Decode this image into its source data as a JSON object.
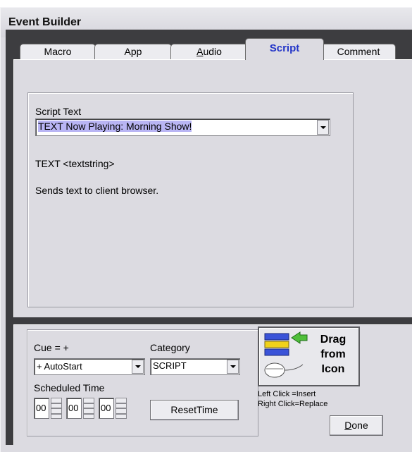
{
  "window": {
    "title": "Event Builder"
  },
  "tabs": [
    {
      "label": "Macro",
      "active": false
    },
    {
      "label": "App",
      "active": false
    },
    {
      "label": "Audio",
      "accel": "A",
      "rest": "udio",
      "active": false
    },
    {
      "label": "Script",
      "active": true
    },
    {
      "label": "Comment",
      "active": false
    }
  ],
  "script": {
    "label": "Script Text",
    "value": "TEXT Now Playing: Morning Show!",
    "syntax": "TEXT <textstring>",
    "description": "Sends text to client browser."
  },
  "cue": {
    "label": "Cue = +",
    "value": "+ AutoStart"
  },
  "category": {
    "label": "Category",
    "value": "SCRIPT"
  },
  "scheduled": {
    "label": "Scheduled Time",
    "hours": "00",
    "minutes": "00",
    "seconds": "00",
    "reset_label": "ResetTime"
  },
  "drag": {
    "line1": "Drag",
    "line2": "from",
    "line3": "Icon",
    "hint_left": "Left Click  =Insert",
    "hint_right": "Right Click=Replace"
  },
  "done": {
    "label": "Done",
    "accel": "D",
    "rest": "one"
  },
  "colors": {
    "active_tab": "#2436c8",
    "selection": "#b9b5f4",
    "background": "#dcdbe1"
  }
}
